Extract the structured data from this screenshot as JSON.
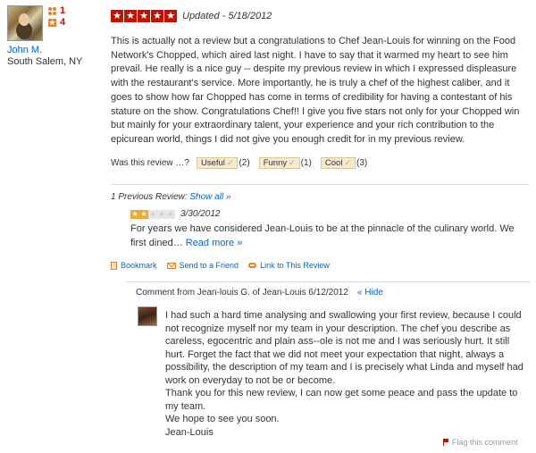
{
  "user": {
    "name": "John M.",
    "location": "South Salem, NY",
    "friends_count": "1",
    "reviews_count": "4"
  },
  "review": {
    "rating": 5,
    "star_glyph": "★",
    "updated": "Updated - 5/18/2012",
    "text": "This is actually not a review but a congratulations to Chef Jean-Louis for winning on the Food Network's Chopped, which aired last night. I have to say that it warmed my heart to see him prevail. He really is a nice guy -- despite my previous review in which I expressed displeasure with the restaurant's service. More importantly, he is truly a chef of the highest caliber, and it goes to show how far Chopped has come in terms of credibility for having a contestant of his stature on the show. Congratulations Chef!! I give you five stars not only for your Chopped win but mainly for your extraordinary talent, your experience and your rich contribution to the epicurean world, things I did not give you enough credit for in my previous review."
  },
  "votes": {
    "prompt": "Was this review …?",
    "check": "✓",
    "useful_label": "Useful",
    "useful_count": "(2)",
    "funny_label": "Funny",
    "funny_count": "(1)",
    "cool_label": "Cool",
    "cool_count": "(3)"
  },
  "previous": {
    "heading": "1 Previous Review: ",
    "show_all": "Show all »",
    "rating": 2,
    "date": "3/30/2012",
    "text": "For years we have considered Jean-Louis to be at the pinnacle of the culinary world. We first dined… ",
    "read_more": "Read more »"
  },
  "actions": {
    "bookmark": "Bookmark",
    "send": "Send to a Friend",
    "link": "Link to This Review"
  },
  "comment": {
    "header": "Comment from Jean-louis G. of Jean-Louis 6/12/2012",
    "hide": "« Hide",
    "text": "I had such a hard time analysing and swallowing  your first review, because I could not recognize myself nor my team in your description. The chef you describe as careless, egocentric and plain ass--ole is not me and I was seriously hurt. It still hurt. Forget the fact that we did not meet your expectation that night, always a possibility, the description of my team and I is precisely what Linda and myself had work on everyday to not be or become.\nThank you for this new review, I can now get some peace and pass the update to my team.\nWe hope to see you soon.\nJean-Louis",
    "flag": "Flag this comment"
  },
  "colors": {
    "accent_red": "#c41200",
    "link_blue": "#0066cc",
    "orange": "#f07e22"
  }
}
